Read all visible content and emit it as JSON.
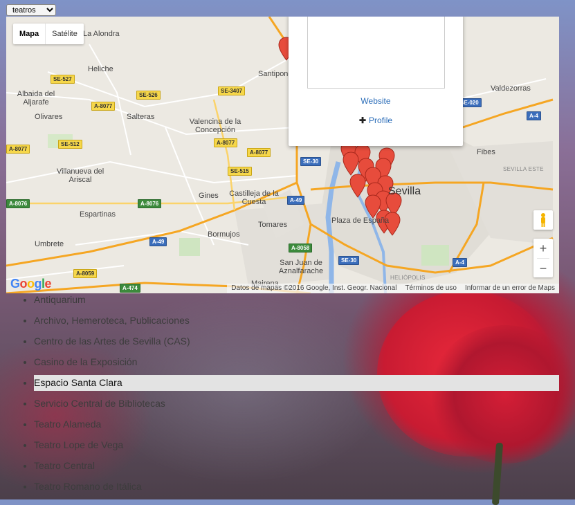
{
  "layer_select": {
    "value": "teatros"
  },
  "map": {
    "type_controls": {
      "map": "Mapa",
      "satellite": "Satélite"
    },
    "place_labels": [
      "La Alondra",
      "Heliche",
      "Albaida del Aljarafe",
      "Olivares",
      "Salteras",
      "Valencina de la Concepción",
      "Villanueva del Ariscal",
      "Castilleja de la Cuesta",
      "Gines",
      "Espartinas",
      "Tomares",
      "Bormujos",
      "Umbrete",
      "San Juan de Aznalfarache",
      "Mairena",
      "Santiponce",
      "Valdezorras",
      "Fibes",
      "SEVILLA ESTE",
      "HELIÓPOLIS",
      "Plaza de España",
      "Sevilla"
    ],
    "road_shields": [
      "SE-527",
      "SE-526",
      "SE-3407",
      "A-8077",
      "SE-512",
      "A-8077",
      "A-8077",
      "SE-515",
      "A-8076",
      "A-8076",
      "A-49",
      "A-49",
      "A-8059",
      "A-474",
      "SE-30",
      "SE-30",
      "A-8058",
      "A-4",
      "A-4",
      "SE-020",
      "A-8077"
    ],
    "info_window": {
      "website_link": "Website",
      "profile_link": "Profile",
      "profile_icon": "plus-icon"
    },
    "zoom_in": "+",
    "zoom_out": "−",
    "logo": [
      "G",
      "o",
      "o",
      "g",
      "l",
      "e"
    ],
    "attribution": {
      "data": "Datos de mapas ©2016 Google, Inst. Geogr. Nacional",
      "terms": "Términos de uso",
      "report": "Informar de un error de Maps"
    },
    "colors": {
      "marker": "#e74c3c",
      "motorway": "#f5a623",
      "river": "#8fb6e8"
    }
  },
  "places": [
    "Antiquarium",
    "Archivo, Hemeroteca, Publicaciones",
    "Centro de las Artes de Sevilla (CAS)",
    "Casino de la Exposición",
    "Espacio Santa Clara",
    "Servicio Central de Bibliotecas",
    "Teatro Alameda",
    "Teatro Lope de Vega",
    "Teatro Central",
    "Teatro Romano de Itálica"
  ],
  "selected_place": "Espacio Santa Clara"
}
